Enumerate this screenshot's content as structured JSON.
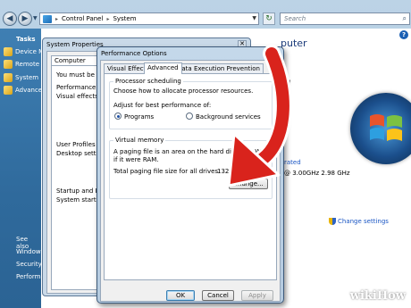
{
  "window": {
    "breadcrumb": [
      "Control Panel",
      "System"
    ],
    "search_placeholder": "Search"
  },
  "sidebar": {
    "title": "Tasks",
    "items": [
      {
        "label": "Device M",
        "icon": "shield-icon"
      },
      {
        "label": "Remote s",
        "icon": "shield-icon"
      },
      {
        "label": "System pr",
        "icon": "shield-icon"
      },
      {
        "label": "Advance",
        "icon": "shield-icon"
      }
    ],
    "see_also_title": "See also",
    "see_also": [
      "Windows",
      "Security",
      "Performance"
    ]
  },
  "content": {
    "heading_fragment": "puter",
    "right_fragments": [
      "rd",
      "rated",
      "@ 3.00GHz  2.98 GHz"
    ],
    "change_settings": "Change settings"
  },
  "system_properties": {
    "title": "System Properties",
    "tab": "Computer Name",
    "lines": [
      "You must be lo",
      "Performance",
      "Visual effects",
      "User Profiles",
      "Desktop settin",
      "Startup and R",
      "System startup"
    ]
  },
  "performance_options": {
    "title": "Performance Options",
    "tabs": [
      "Visual Effects",
      "Advanced",
      "Data Execution Prevention"
    ],
    "active_tab": "Advanced",
    "processor": {
      "group": "Processor scheduling",
      "description": "Choose how to allocate processor resources.",
      "adjust_label": "Adjust for best performance of:",
      "options": [
        "Programs",
        "Background services"
      ],
      "selected": "Programs"
    },
    "virtual_memory": {
      "group": "Virtual memory",
      "description_line1": "A paging file is an area on the hard disk that Windo",
      "description_line2": "if it were RAM.",
      "total_label": "Total paging file size for all drives:",
      "total_value": "1323 MB",
      "change_button": "Change..."
    },
    "buttons": {
      "ok": "OK",
      "cancel": "Cancel",
      "apply": "Apply"
    }
  },
  "watermark": {
    "brand_a": "wiki",
    "brand_b": "How"
  }
}
